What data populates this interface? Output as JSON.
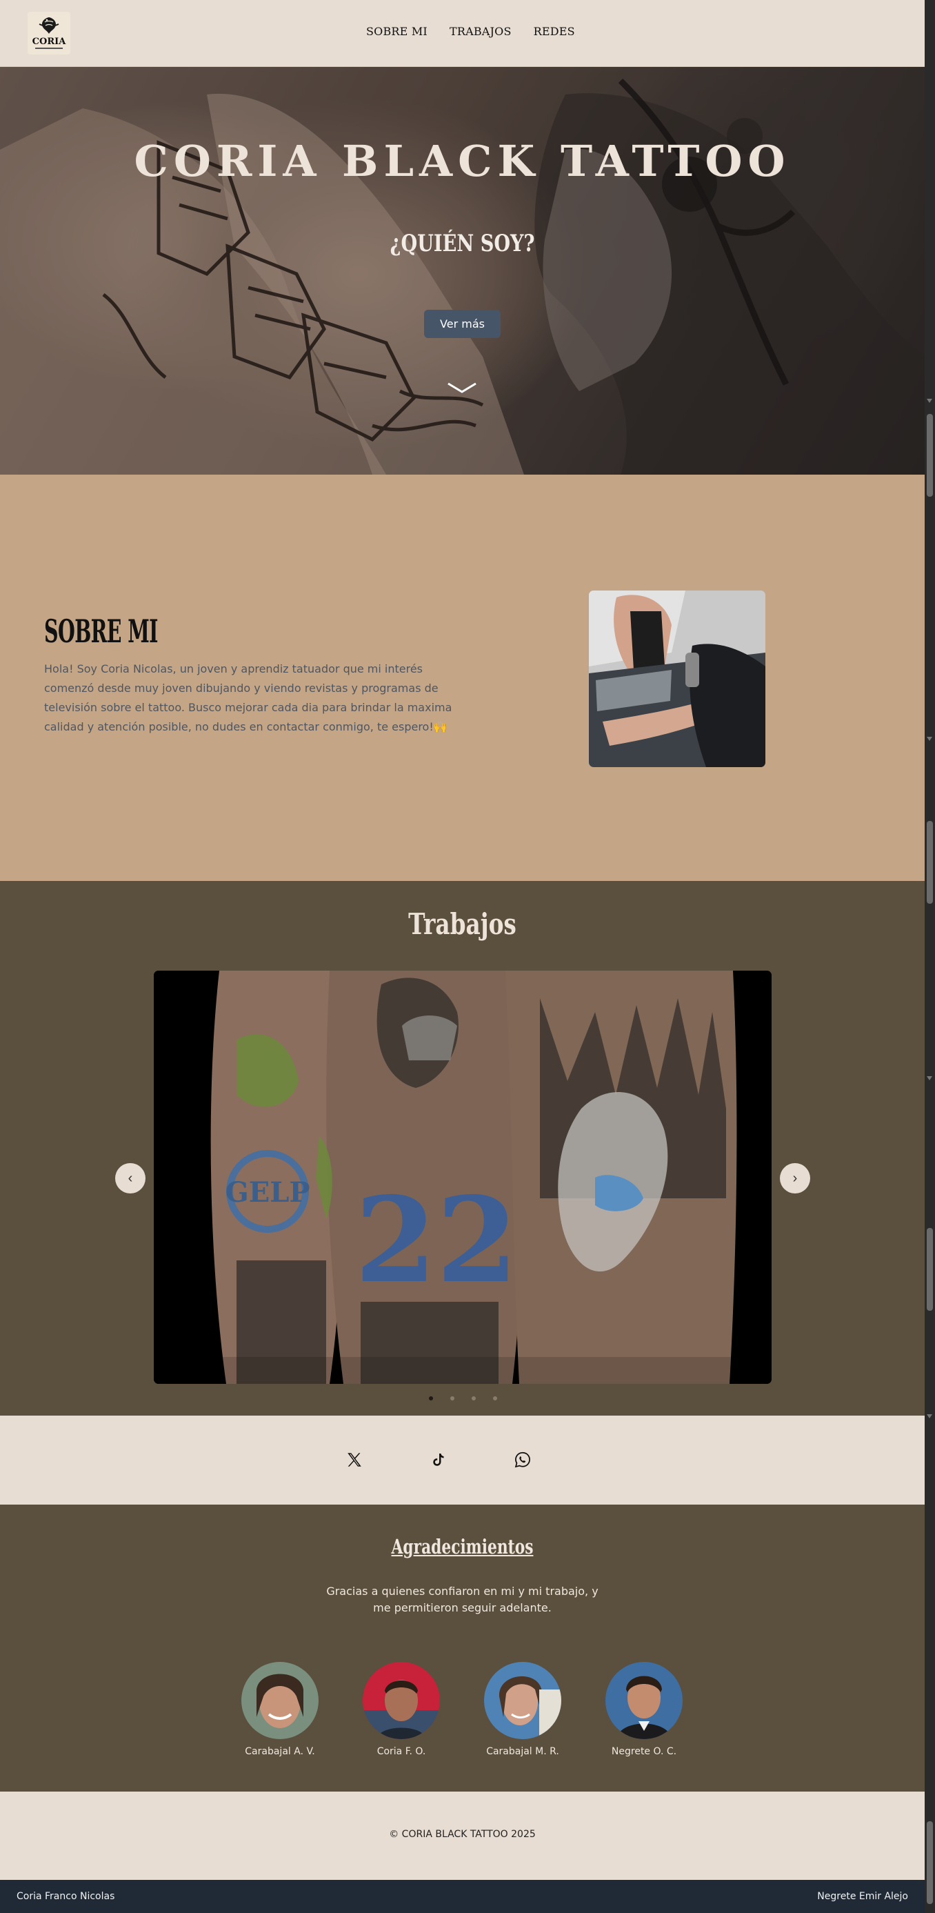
{
  "header": {
    "logo_text": "CORIA",
    "nav": [
      "SOBRE MI",
      "TRABAJOS",
      "REDES"
    ]
  },
  "hero": {
    "title": "CORIA BLACK TATTOO",
    "subtitle": "¿QUIÉN SOY?",
    "button_label": "Ver más"
  },
  "about": {
    "title": "SOBRE MI",
    "text": "Hola! Soy Coria Nicolas, un joven y aprendiz tatuador que mi interés comenzó desde muy joven dibujando y viendo revistas y programas de televisión sobre el tattoo. Busco mejorar cada dia para brindar la maxima calidad y atención posible, no dudes en contactar conmigo, te espero!🙌"
  },
  "works": {
    "title": "Trabajos",
    "prev_glyph": "‹",
    "next_glyph": "›",
    "slide_count": 4,
    "active_slide": 1,
    "slide_number": "22"
  },
  "socials": [
    "x-icon",
    "tiktok-icon",
    "whatsapp-icon"
  ],
  "thanks": {
    "title": "Agradecimientos",
    "text": "Gracias a quienes confiaron en mi y mi trabajo, y me permitieron seguir adelante.",
    "people": [
      {
        "name": "Carabajal A. V."
      },
      {
        "name": "Coria F. O."
      },
      {
        "name": "Carabajal M. R."
      },
      {
        "name": "Negrete O. C."
      }
    ]
  },
  "footer": {
    "copyright": "© CORIA BLACK TATTOO 2025",
    "credit_left": "Coria Franco Nicolas",
    "credit_right": "Negrete Emir Alejo"
  },
  "colors": {
    "header_bg": "#e8ddd2",
    "about_bg": "#c4a686",
    "works_bg": "#5b4f3e",
    "button_bg": "#475569",
    "credits_bg": "#1f2a36"
  }
}
